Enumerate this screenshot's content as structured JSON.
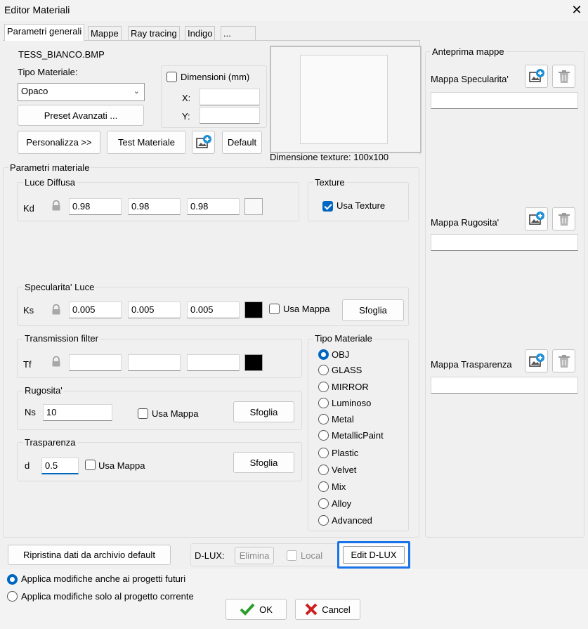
{
  "window": {
    "title": "Editor Materiali",
    "close": "✕"
  },
  "tabs": [
    "Parametri generali",
    "Mappe",
    "Ray tracing",
    "Indigo",
    "..."
  ],
  "general": {
    "filename": "TESS_BIANCO.BMP",
    "tipo_materiale_label": "Tipo Materiale:",
    "tipo_materiale_value": "Opaco",
    "preset_button": "Preset Avanzati ...",
    "dimensioni_label": "Dimensioni (mm)",
    "x_label": "X:",
    "y_label": "Y:",
    "x_value": "",
    "y_value": "",
    "personalizza_button": "Personalizza >>",
    "test_button": "Test Materiale",
    "default_button": "Default",
    "texture_size_label": "Dimensione texture:  100x100"
  },
  "params": {
    "group_label": "Parametri materiale",
    "diffuse": {
      "label": "Luce Diffusa",
      "prefix": "Kd",
      "values": [
        "0.98",
        "0.98",
        "0.98"
      ],
      "color": "#f8f8f8"
    },
    "texture": {
      "label": "Texture",
      "checkbox": "Usa Texture"
    },
    "specular": {
      "label": "Specularita' Luce",
      "prefix": "Ks",
      "values": [
        "0.005",
        "0.005",
        "0.005"
      ],
      "color": "#000000",
      "checkbox": "Usa Mappa",
      "button": "Sfoglia"
    },
    "transmission": {
      "label": "Transmission filter",
      "prefix": "Tf",
      "values": [
        "",
        "",
        ""
      ],
      "color": "#000000"
    },
    "rugosita": {
      "label": "Rugosita'",
      "prefix": "Ns",
      "value": "10",
      "checkbox": "Usa Mappa",
      "button": "Sfoglia"
    },
    "trasparenza": {
      "label": "Trasparenza",
      "prefix": "d",
      "value": "0.5",
      "checkbox": "Usa Mappa",
      "button": "Sfoglia"
    },
    "tipo": {
      "label": "Tipo Materiale",
      "options": [
        "OBJ",
        "GLASS",
        "MIRROR",
        "Luminoso",
        "Metal",
        "MetallicPaint",
        "Plastic",
        "Velvet",
        "Mix",
        "Alloy",
        "Advanced"
      ],
      "selected": "OBJ"
    }
  },
  "preview": {
    "group_label": "Anteprima mappe",
    "items": [
      "Mappa Specularita'",
      "Mappa Rugosita'",
      "Mappa Trasparenza"
    ]
  },
  "bottom": {
    "restore_button": "Ripristina dati da archivio default",
    "dlux_label": "D-LUX:",
    "elimina_button": "Elimina",
    "local_checkbox": "Local",
    "edit_button": "Edit D-LUX",
    "apply_future": "Applica modifiche anche ai progetti futuri",
    "apply_current": "Applica modifiche solo al progetto corrente",
    "ok_button": "OK",
    "cancel_button": "Cancel"
  },
  "colors": {
    "accent": "#0067c0",
    "focus_ring": "#1a73e8",
    "ok_check": "#2a9d2a",
    "cancel_x": "#cc2020"
  }
}
